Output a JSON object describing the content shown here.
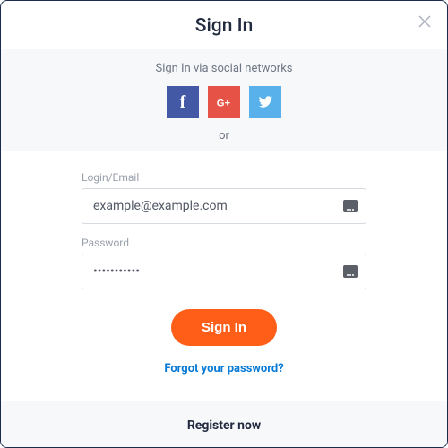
{
  "header": {
    "title": "Sign In"
  },
  "social": {
    "text": "Sign In via social networks",
    "or": "or"
  },
  "form": {
    "login_label": "Login/Email",
    "login_value": "example@example.com",
    "password_label": "Password",
    "password_value": "•••••••••••",
    "submit_label": "Sign In",
    "forgot_label": "Forgot your password?"
  },
  "footer": {
    "register_label": "Register now"
  }
}
